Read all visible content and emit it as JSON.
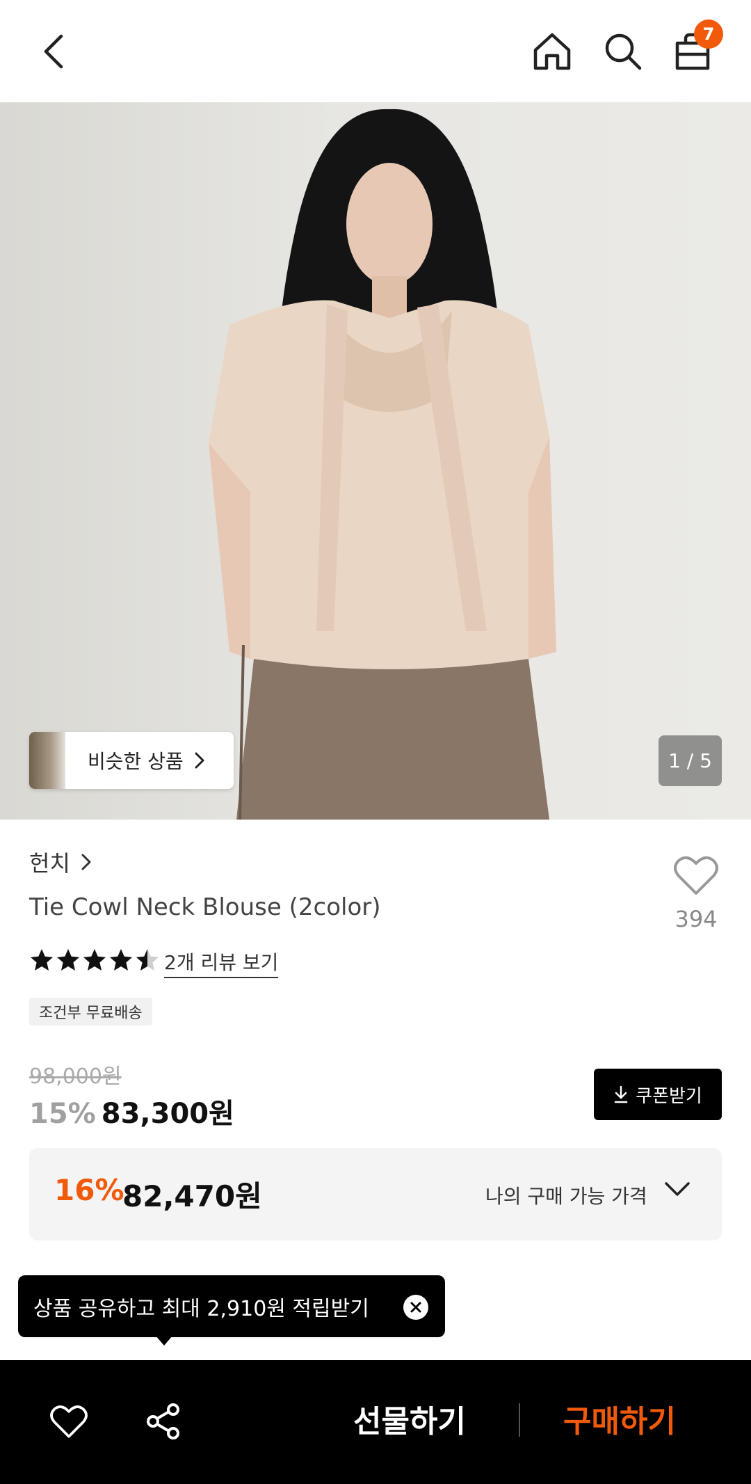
{
  "header": {
    "back_icon": "chevron-left-icon",
    "home_icon": "home-icon",
    "search_icon": "search-icon",
    "cart_icon": "shopping-bag-icon",
    "cart_count": "7",
    "badge_color": "#f25a0b"
  },
  "gallery": {
    "similar_label": "비슷한 상품",
    "page_indicator": "1 / 5"
  },
  "product": {
    "brand": "헌치",
    "title": "Tie Cowl Neck Blouse (2color)",
    "wish_count": "394",
    "rating": 4.5,
    "review_link": "2개 리뷰 보기",
    "shipping_tag": "조건부 무료배송",
    "original_price": "98,000원",
    "discount": "15%",
    "price": "83,300원",
    "coupon_label": "쿠폰받기"
  },
  "my_price": {
    "discount": "16%",
    "price": "82,470원",
    "label": "나의 구매 가능 가격",
    "accent_color": "#f25a0b"
  },
  "tooltip": {
    "text": "상품 공유하고 최대 2,910원 적립받기"
  },
  "bottom_bar": {
    "gift_label": "선물하기",
    "buy_label": "구매하기",
    "buy_color": "#f25a0b"
  }
}
